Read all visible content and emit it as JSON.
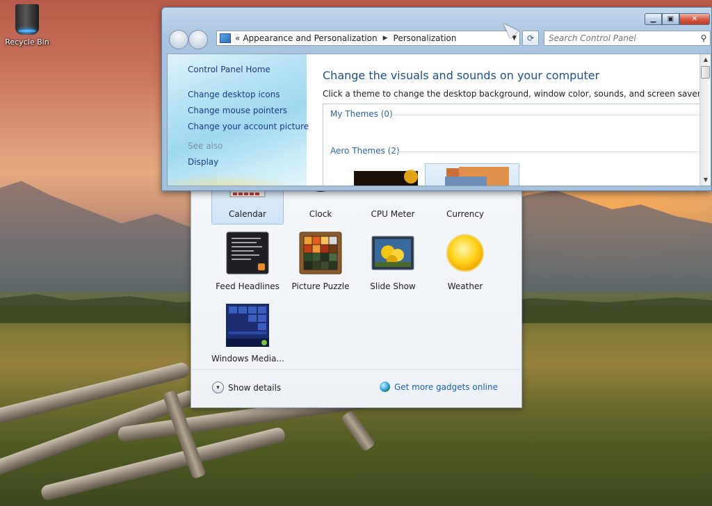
{
  "desktop": {
    "icons": [
      {
        "label": "Recycle Bin",
        "icon": "recycle-bin-icon"
      }
    ]
  },
  "gadgets": {
    "items": [
      {
        "label": "Calendar",
        "icon": "calendar-gadget-icon",
        "selected": true
      },
      {
        "label": "Clock",
        "icon": "clock-gadget-icon"
      },
      {
        "label": "CPU Meter",
        "icon": "cpu-meter-gadget-icon"
      },
      {
        "label": "Currency",
        "icon": "currency-gadget-icon"
      },
      {
        "label": "Feed Headlines",
        "icon": "feed-headlines-gadget-icon"
      },
      {
        "label": "Picture Puzzle",
        "icon": "picture-puzzle-gadget-icon"
      },
      {
        "label": "Slide Show",
        "icon": "slide-show-gadget-icon"
      },
      {
        "label": "Weather",
        "icon": "weather-gadget-icon"
      },
      {
        "label": "Windows Media...",
        "icon": "windows-media-gadget-icon"
      }
    ],
    "footer": {
      "show_details": "Show details",
      "get_more": "Get more gadgets online"
    }
  },
  "window": {
    "address": {
      "overflow": "«",
      "crumbs": [
        "Appearance and Personalization",
        "Personalization"
      ]
    },
    "search_placeholder": "Search Control Panel",
    "sidebar": {
      "home": "Control Panel Home",
      "links": [
        "Change desktop icons",
        "Change mouse pointers",
        "Change your account picture"
      ],
      "see_also": "See also",
      "see_also_links": [
        "Display"
      ]
    },
    "main": {
      "title": "Change the visuals and sounds on your computer",
      "description": "Click a theme to change the desktop background, window color, sounds, and screen saver all at once.",
      "groups": [
        "My Themes (0)",
        "Aero Themes (2)"
      ]
    },
    "colors": {
      "link": "#18398a",
      "heading": "#1d4f91",
      "group": "#2a64a8",
      "close_button": "#c23a22"
    }
  }
}
